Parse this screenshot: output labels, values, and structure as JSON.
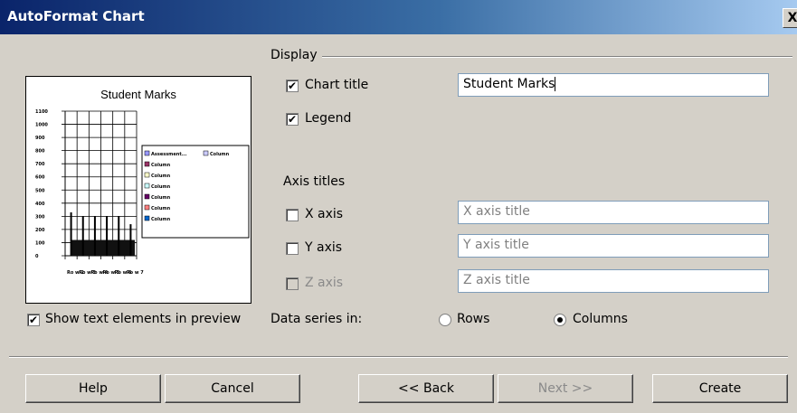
{
  "window": {
    "title": "AutoFormat Chart",
    "close_label": "X"
  },
  "preview": {
    "show_text_label": "Show text elements in preview",
    "show_text_checked": true,
    "chart_data": {
      "type": "bar",
      "title": "Student Marks",
      "ylim": [
        0,
        1100
      ],
      "yticks": [
        "1100",
        "1000",
        "900",
        "800",
        "700",
        "600",
        "500",
        "400",
        "300",
        "200",
        "100",
        "0"
      ],
      "categories": [
        "Ro w 2",
        "Ro w 3",
        "Ro w 4",
        "Ro w 5",
        "Ro w 6",
        "Ro w 7"
      ],
      "values": [
        330,
        300,
        300,
        300,
        300,
        240
      ],
      "legend": [
        "Assessment...",
        "Column"
      ]
    }
  },
  "display": {
    "group_label": "Display",
    "chart_title_label": "Chart title",
    "chart_title_checked": true,
    "chart_title_value": "Student Marks",
    "legend_label": "Legend",
    "legend_checked": true
  },
  "axis_titles": {
    "group_label": "Axis titles",
    "x_label": "X axis",
    "x_placeholder": "X axis title",
    "y_label": "Y axis",
    "y_placeholder": "Y axis title",
    "z_label": "Z axis",
    "z_placeholder": "Z axis title"
  },
  "data_series": {
    "label": "Data series in:",
    "rows_label": "Rows",
    "columns_label": "Columns",
    "selected": "Columns"
  },
  "buttons": {
    "help": "Help",
    "cancel": "Cancel",
    "back": "<< Back",
    "next": "Next >>",
    "create": "Create"
  }
}
